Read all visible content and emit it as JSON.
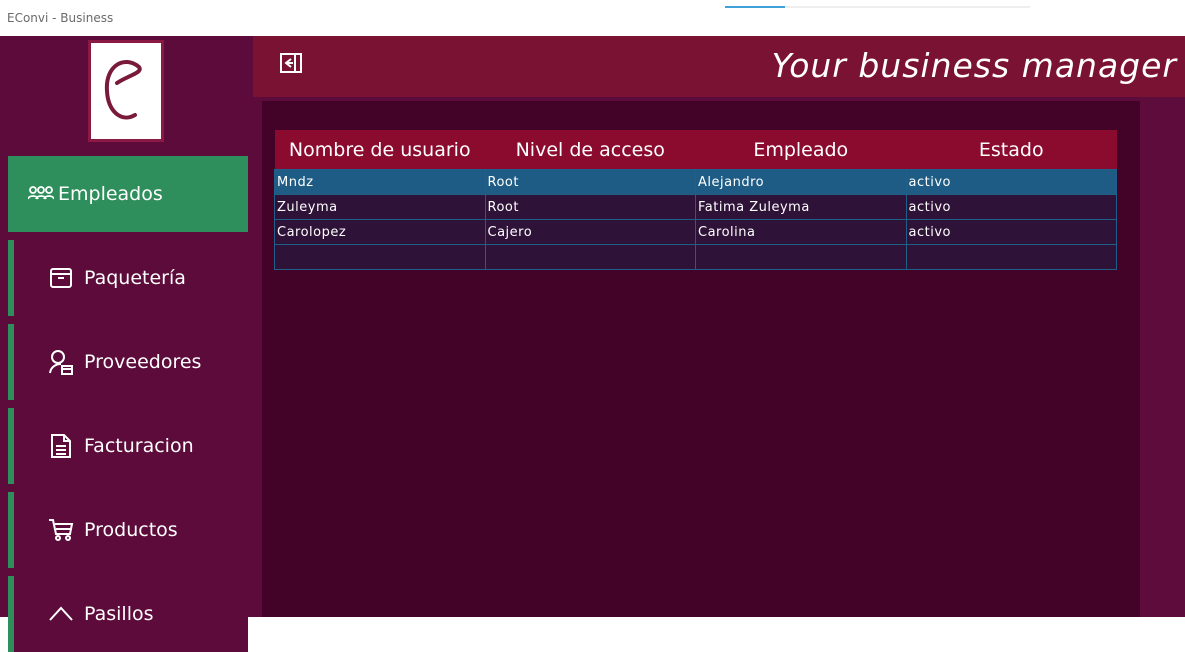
{
  "window": {
    "title": "EConvi - Business"
  },
  "header": {
    "brand_text": "Your business manager"
  },
  "sidebar": {
    "items": [
      {
        "label": "Empleados",
        "icon": "people-icon",
        "active": true
      },
      {
        "label": "Paquetería",
        "icon": "package-icon",
        "active": false
      },
      {
        "label": "Proveedores",
        "icon": "supplier-icon",
        "active": false
      },
      {
        "label": "Facturacion",
        "icon": "document-icon",
        "active": false
      },
      {
        "label": "Productos",
        "icon": "cart-icon",
        "active": false
      },
      {
        "label": "Pasillos",
        "icon": "aisle-icon",
        "active": false
      }
    ]
  },
  "table": {
    "columns": [
      "Nombre de usuario",
      "Nivel de acceso",
      "Empleado",
      "Estado"
    ],
    "rows": [
      [
        "Mndz",
        "Root",
        "Alejandro",
        "activo"
      ],
      [
        "Zuleyma",
        "Root",
        "Fatima Zuleyma",
        "activo"
      ],
      [
        "Carolopez",
        "Cajero",
        "Carolina",
        "activo"
      ],
      [
        "",
        "",
        "",
        ""
      ]
    ]
  },
  "colors": {
    "sidebar_bg": "#5c0b3a",
    "active_nav": "#2f8f5c",
    "header_bg": "#7a1233",
    "table_header": "#8b0b2f",
    "selected_row": "#1e5c86",
    "panel_bg": "#430328"
  }
}
